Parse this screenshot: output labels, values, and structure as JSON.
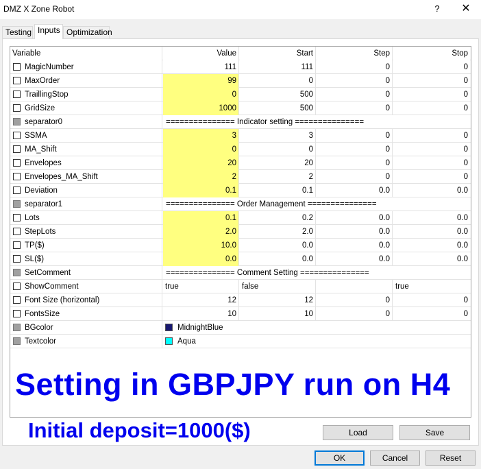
{
  "window": {
    "title": "DMZ X Zone Robot",
    "help": "?",
    "close": "✕"
  },
  "tabs": [
    "Testing",
    "Inputs",
    "Optimization"
  ],
  "columns": {
    "variable": "Variable",
    "value": "Value",
    "start": "Start",
    "step": "Step",
    "stop": "Stop"
  },
  "rows": [
    {
      "kind": "param",
      "name": "MagicNumber",
      "value": "111",
      "start": "111",
      "step": "0",
      "stop": "0",
      "hl": false
    },
    {
      "kind": "param",
      "name": "MaxOrder",
      "value": "99",
      "start": "0",
      "step": "0",
      "stop": "0",
      "hl": true
    },
    {
      "kind": "param",
      "name": "TraillingStop",
      "value": "0",
      "start": "500",
      "step": "0",
      "stop": "0",
      "hl": true
    },
    {
      "kind": "param",
      "name": "GridSize",
      "value": "1000",
      "start": "500",
      "step": "0",
      "stop": "0",
      "hl": true
    },
    {
      "kind": "sep",
      "name": "separator0",
      "text": "=============== Indicator setting ==============="
    },
    {
      "kind": "param",
      "name": "SSMA",
      "value": "3",
      "start": "3",
      "step": "0",
      "stop": "0",
      "hl": true
    },
    {
      "kind": "param",
      "name": "MA_Shift",
      "value": "0",
      "start": "0",
      "step": "0",
      "stop": "0",
      "hl": true
    },
    {
      "kind": "param",
      "name": "Envelopes",
      "value": "20",
      "start": "20",
      "step": "0",
      "stop": "0",
      "hl": true
    },
    {
      "kind": "param",
      "name": "Envelopes_MA_Shift",
      "value": "2",
      "start": "2",
      "step": "0",
      "stop": "0",
      "hl": true
    },
    {
      "kind": "param",
      "name": "Deviation",
      "value": "0.1",
      "start": "0.1",
      "step": "0.0",
      "stop": "0.0",
      "hl": true
    },
    {
      "kind": "sep",
      "name": "separator1",
      "text": "=============== Order Management ==============="
    },
    {
      "kind": "param",
      "name": "Lots",
      "value": "0.1",
      "start": "0.2",
      "step": "0.0",
      "stop": "0.0",
      "hl": true
    },
    {
      "kind": "param",
      "name": "StepLots",
      "value": "2.0",
      "start": "2.0",
      "step": "0.0",
      "stop": "0.0",
      "hl": true
    },
    {
      "kind": "param",
      "name": "TP($)",
      "value": "10.0",
      "start": "0.0",
      "step": "0.0",
      "stop": "0.0",
      "hl": true
    },
    {
      "kind": "param",
      "name": "SL($)",
      "value": "0.0",
      "start": "0.0",
      "step": "0.0",
      "stop": "0.0",
      "hl": true
    },
    {
      "kind": "sep",
      "name": "SetComment",
      "text": "=============== Comment Setting ==============="
    },
    {
      "kind": "bool",
      "name": "ShowComment",
      "value": "true",
      "start": "false",
      "step": "",
      "stop": "true"
    },
    {
      "kind": "param",
      "name": "Font Size (horizontal)",
      "value": "12",
      "start": "12",
      "step": "0",
      "stop": "0",
      "hl": false
    },
    {
      "kind": "param",
      "name": "FontsSize",
      "value": "10",
      "start": "10",
      "step": "0",
      "stop": "0",
      "hl": false
    },
    {
      "kind": "color",
      "name": "BGcolor",
      "value": "MidnightBlue",
      "swatch": "#191970"
    },
    {
      "kind": "color",
      "name": "Textcolor",
      "value": "Aqua",
      "swatch": "#00ffff"
    }
  ],
  "overlay": {
    "line1": "Setting in GBPJPY run on H4",
    "line2": "Initial deposit=1000($)"
  },
  "buttons": {
    "load": "Load",
    "save": "Save",
    "ok": "OK",
    "cancel": "Cancel",
    "reset": "Reset"
  }
}
